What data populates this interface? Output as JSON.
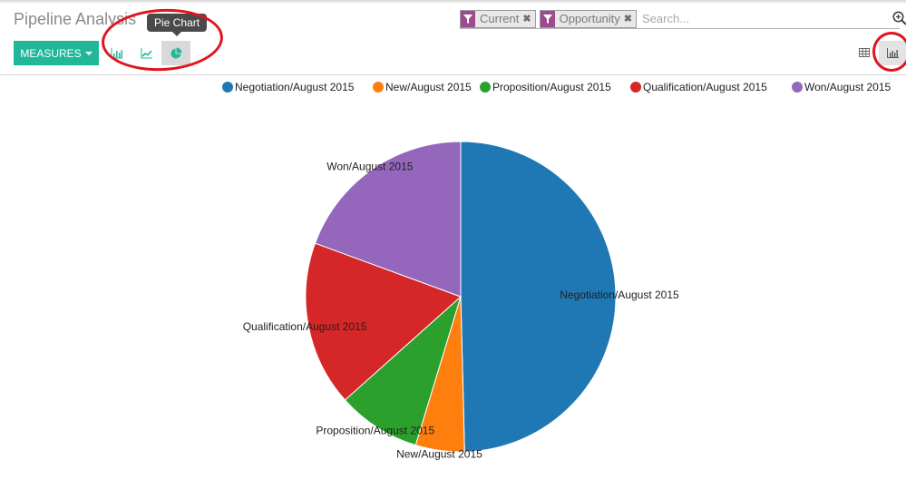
{
  "header": {
    "title": "Pipeline Analysis",
    "tooltip": "Pie Chart",
    "measures_label": "MEASURES",
    "chart_modes": [
      {
        "name": "bar-chart",
        "icon": "bar-chart-icon",
        "active": false
      },
      {
        "name": "line-chart",
        "icon": "line-chart-icon",
        "active": false
      },
      {
        "name": "pie-chart",
        "icon": "pie-chart-icon",
        "active": true
      }
    ]
  },
  "search": {
    "facets": [
      {
        "label": "Current",
        "icon": "filter-icon"
      },
      {
        "label": "Opportunity",
        "icon": "filter-icon"
      }
    ],
    "placeholder": "Search...",
    "value": ""
  },
  "views": [
    {
      "name": "pivot",
      "icon": "grid-icon",
      "active": false
    },
    {
      "name": "graph",
      "icon": "bar-chart-icon",
      "active": true
    }
  ],
  "colors": {
    "accent": "#21b799",
    "facet": "#9c4b8e",
    "annotation": "#e0141e"
  },
  "chart_data": {
    "type": "pie",
    "title": "",
    "legend_position": "top-right",
    "labels": [
      "Negotiation/August 2015",
      "New/August 2015",
      "Proposition/August 2015",
      "Qualification/August 2015",
      "Won/August 2015"
    ],
    "values": [
      49.6,
      5.1,
      8.7,
      17.2,
      19.4
    ],
    "colors": [
      "#1f77b4",
      "#ff7f0e",
      "#2ca02c",
      "#d62728",
      "#9467bd"
    ]
  }
}
